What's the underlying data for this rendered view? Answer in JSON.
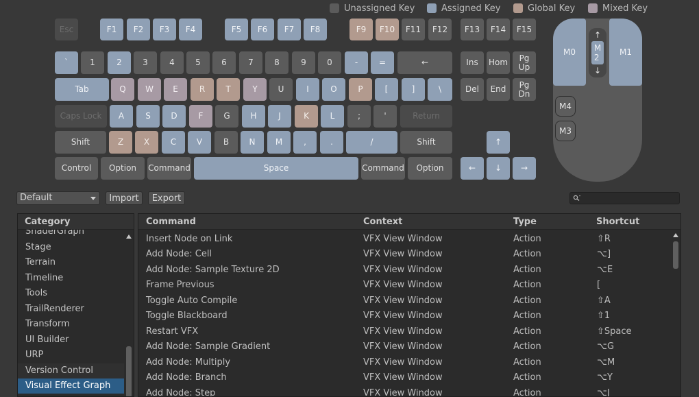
{
  "colors": {
    "unassigned": "#5b5b5b",
    "assigned": "#8fa0b5",
    "global": "#b29a8e",
    "mixed": "#a79aa4",
    "selection": "#2c5d87"
  },
  "legend": {
    "unassigned": "Unassigned Key",
    "assigned": "Assigned Key",
    "global": "Global Key",
    "mixed": "Mixed Key"
  },
  "keys": {
    "esc": "Esc",
    "f1": "F1",
    "f2": "F2",
    "f3": "F3",
    "f4": "F4",
    "f5": "F5",
    "f6": "F6",
    "f7": "F7",
    "f8": "F8",
    "f9": "F9",
    "f10": "F10",
    "f11": "F11",
    "f12": "F12",
    "f13": "F13",
    "f14": "F14",
    "f15": "F15",
    "backquote": "`",
    "n1": "1",
    "n2": "2",
    "n3": "3",
    "n4": "4",
    "n5": "5",
    "n6": "6",
    "n7": "7",
    "n8": "8",
    "n9": "9",
    "n0": "0",
    "minus": "-",
    "equals": "=",
    "backspace": "←",
    "ins": "Ins",
    "home": "Hom",
    "pgup": "Pg\nUp",
    "tab": "Tab",
    "q": "Q",
    "w": "W",
    "e": "E",
    "r": "R",
    "t": "T",
    "y": "Y",
    "u": "U",
    "i": "I",
    "o": "O",
    "p": "P",
    "lbracket": "[",
    "rbracket": "]",
    "backslash": "\\",
    "del": "Del",
    "end": "End",
    "pgdn": "Pg\nDn",
    "capslock": "Caps Lock",
    "a": "A",
    "s": "S",
    "d": "D",
    "f": "F",
    "g": "G",
    "h": "H",
    "j": "J",
    "k": "K",
    "l": "L",
    "semicolon": ";",
    "quote": "'",
    "return": "Return",
    "lshift": "Shift",
    "z": "Z",
    "x": "X",
    "c": "C",
    "v": "V",
    "b": "B",
    "n": "N",
    "m": "M",
    "comma": ",",
    "period": ".",
    "slash": "/",
    "rshift": "Shift",
    "uparrow": "↑",
    "lcontrol": "Control",
    "loption": "Option",
    "lcommand": "Command",
    "space": "Space",
    "rcommand": "Command",
    "roption": "Option",
    "leftarrow": "←",
    "downarrow": "↓",
    "rightarrow": "→"
  },
  "mouse": {
    "m0": "M0",
    "m1": "M1",
    "m2_up": "↑",
    "m2": "M\n2",
    "m2_down": "↓",
    "m3": "M3",
    "m4": "M4"
  },
  "toolbar": {
    "profile": "Default",
    "import_label": "Import",
    "export_label": "Export",
    "search_placeholder": ""
  },
  "category": {
    "header": "Category",
    "items": [
      "ShaderGraph",
      "Stage",
      "Terrain",
      "Timeline",
      "Tools",
      "TrailRenderer",
      "Transform",
      "UI Builder",
      "URP",
      "Version Control",
      "Visual Effect Graph"
    ],
    "selected_index": 10
  },
  "commands": {
    "headers": {
      "command": "Command",
      "context": "Context",
      "type": "Type",
      "shortcut": "Shortcut"
    },
    "rows": [
      {
        "command": "Insert Node on Link",
        "context": "VFX View Window",
        "type": "Action",
        "shortcut": "⇧R"
      },
      {
        "command": "Add Node: Cell",
        "context": "VFX View Window",
        "type": "Action",
        "shortcut": "⌥]"
      },
      {
        "command": "Add Node: Sample Texture 2D",
        "context": "VFX View Window",
        "type": "Action",
        "shortcut": "⌥E"
      },
      {
        "command": "Frame Previous",
        "context": "VFX View Window",
        "type": "Action",
        "shortcut": "["
      },
      {
        "command": "Toggle Auto Compile",
        "context": "VFX View Window",
        "type": "Action",
        "shortcut": "⇧A"
      },
      {
        "command": "Toggle Blackboard",
        "context": "VFX View Window",
        "type": "Action",
        "shortcut": "⇧1"
      },
      {
        "command": "Restart VFX",
        "context": "VFX View Window",
        "type": "Action",
        "shortcut": "⇧Space"
      },
      {
        "command": "Add Node: Sample Gradient",
        "context": "VFX View Window",
        "type": "Action",
        "shortcut": "⌥G"
      },
      {
        "command": "Add Node: Multiply",
        "context": "VFX View Window",
        "type": "Action",
        "shortcut": "⌥M"
      },
      {
        "command": "Add Node: Branch",
        "context": "VFX View Window",
        "type": "Action",
        "shortcut": "⌥Y"
      },
      {
        "command": "Add Node: Step",
        "context": "VFX View Window",
        "type": "Action",
        "shortcut": "⌥J"
      }
    ]
  }
}
